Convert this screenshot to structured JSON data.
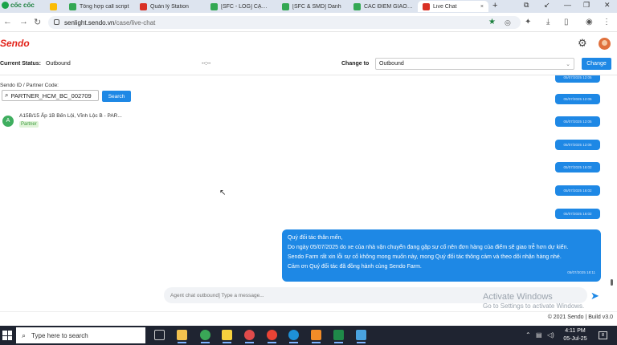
{
  "browser": {
    "brand": "cốc cốc",
    "tabs": [
      {
        "label": "",
        "color": "#4285f4",
        "active": false,
        "close": ""
      },
      {
        "label": "Tổng hợp call script",
        "color": "#34a853",
        "active": false,
        "close": ""
      },
      {
        "label": "Quản lý Station",
        "color": "#d93025",
        "active": false,
        "close": ""
      },
      {
        "label": "[SFC - LOG] CẬP NHẬ",
        "color": "#34a853",
        "active": false,
        "close": ""
      },
      {
        "label": "[SFC & SMD] Danh",
        "color": "#34a853",
        "active": false,
        "close": ""
      },
      {
        "label": "CÁC ĐIỂM GIAO TR",
        "color": "#34a853",
        "active": false,
        "close": ""
      },
      {
        "label": "Live Chat",
        "color": "#d93025",
        "active": true,
        "close": "×"
      }
    ],
    "new_tab": "+",
    "url_host": "senlight.sendo.vn",
    "url_path": "/case/live-chat"
  },
  "app": {
    "logo": "Sendo",
    "status_label": "Current Status:",
    "status_value": "Outbound",
    "timer": "--:--",
    "change_to_label": "Change to",
    "change_to_value": "Outbound",
    "change_button": "Change"
  },
  "left": {
    "partner_label": "Sendo ID / Partner Code:",
    "partner_value": "PARTNER_HCM_BC_002709",
    "search_button": "Search",
    "conversation": {
      "avatar_letter": "A",
      "title": "A15B/15 Ấp 1B Bến Lội, Vĩnh Lộc B - PAR...",
      "tag": "Partner"
    }
  },
  "chat": {
    "timestamps": [
      "05/07/2025 12:05",
      "05/07/2025 12:05",
      "05/07/2025 12:05",
      "05/07/2025 12:05",
      "05/07/2025 16:02",
      "05/07/2025 16:02",
      "05/07/2025 16:02"
    ],
    "message_lines": [
      "Quý đối tác thân mến,",
      "Do ngày 05/07/2025 do xe của nhà vận chuyển đang gặp sự cố nên đơn hàng của điểm sẽ giao trễ hơn dự kiến.",
      "Sendo Farm rất xin lỗi sự cố không mong muốn này, mong  Quý đối tác thông cảm và theo dõi nhận hàng nhé.",
      "Cảm ơn Quý đối tác đã đồng hành cùng Sendo Farm."
    ],
    "message_time": "05/07/2025 18:11",
    "composer_placeholder": "Agent chat outbound] Type a message..."
  },
  "watermark": {
    "line1": "Activate Windows",
    "line2": "Go to Settings to activate Windows."
  },
  "footer": "© 2021 Sendo | Build v3.0",
  "taskbar": {
    "search_placeholder": "Type here to search",
    "time": "4:11 PM",
    "date": "05-Jul-25",
    "notification_count": "8"
  }
}
